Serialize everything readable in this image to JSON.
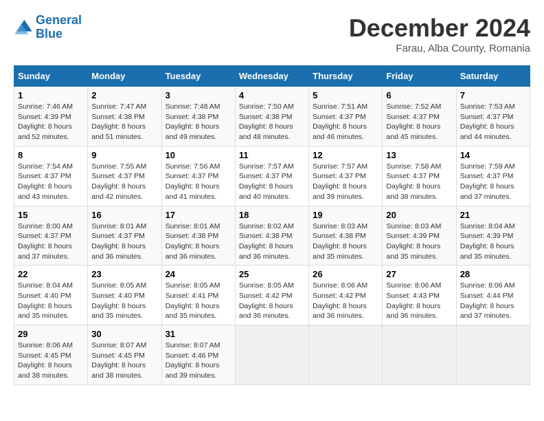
{
  "logo": {
    "line1": "General",
    "line2": "Blue"
  },
  "title": "December 2024",
  "subtitle": "Farau, Alba County, Romania",
  "days_header": [
    "Sunday",
    "Monday",
    "Tuesday",
    "Wednesday",
    "Thursday",
    "Friday",
    "Saturday"
  ],
  "weeks": [
    [
      {
        "day": "1",
        "sunrise": "7:46 AM",
        "sunset": "4:39 PM",
        "daylight": "8 hours and 52 minutes."
      },
      {
        "day": "2",
        "sunrise": "7:47 AM",
        "sunset": "4:38 PM",
        "daylight": "8 hours and 51 minutes."
      },
      {
        "day": "3",
        "sunrise": "7:48 AM",
        "sunset": "4:38 PM",
        "daylight": "8 hours and 49 minutes."
      },
      {
        "day": "4",
        "sunrise": "7:50 AM",
        "sunset": "4:38 PM",
        "daylight": "8 hours and 48 minutes."
      },
      {
        "day": "5",
        "sunrise": "7:51 AM",
        "sunset": "4:37 PM",
        "daylight": "8 hours and 46 minutes."
      },
      {
        "day": "6",
        "sunrise": "7:52 AM",
        "sunset": "4:37 PM",
        "daylight": "8 hours and 45 minutes."
      },
      {
        "day": "7",
        "sunrise": "7:53 AM",
        "sunset": "4:37 PM",
        "daylight": "8 hours and 44 minutes."
      }
    ],
    [
      {
        "day": "8",
        "sunrise": "7:54 AM",
        "sunset": "4:37 PM",
        "daylight": "8 hours and 43 minutes."
      },
      {
        "day": "9",
        "sunrise": "7:55 AM",
        "sunset": "4:37 PM",
        "daylight": "8 hours and 42 minutes."
      },
      {
        "day": "10",
        "sunrise": "7:56 AM",
        "sunset": "4:37 PM",
        "daylight": "8 hours and 41 minutes."
      },
      {
        "day": "11",
        "sunrise": "7:57 AM",
        "sunset": "4:37 PM",
        "daylight": "8 hours and 40 minutes."
      },
      {
        "day": "12",
        "sunrise": "7:57 AM",
        "sunset": "4:37 PM",
        "daylight": "8 hours and 39 minutes."
      },
      {
        "day": "13",
        "sunrise": "7:58 AM",
        "sunset": "4:37 PM",
        "daylight": "8 hours and 38 minutes."
      },
      {
        "day": "14",
        "sunrise": "7:59 AM",
        "sunset": "4:37 PM",
        "daylight": "8 hours and 37 minutes."
      }
    ],
    [
      {
        "day": "15",
        "sunrise": "8:00 AM",
        "sunset": "4:37 PM",
        "daylight": "8 hours and 37 minutes."
      },
      {
        "day": "16",
        "sunrise": "8:01 AM",
        "sunset": "4:37 PM",
        "daylight": "8 hours and 36 minutes."
      },
      {
        "day": "17",
        "sunrise": "8:01 AM",
        "sunset": "4:38 PM",
        "daylight": "8 hours and 36 minutes."
      },
      {
        "day": "18",
        "sunrise": "8:02 AM",
        "sunset": "4:38 PM",
        "daylight": "8 hours and 36 minutes."
      },
      {
        "day": "19",
        "sunrise": "8:03 AM",
        "sunset": "4:38 PM",
        "daylight": "8 hours and 35 minutes."
      },
      {
        "day": "20",
        "sunrise": "8:03 AM",
        "sunset": "4:39 PM",
        "daylight": "8 hours and 35 minutes."
      },
      {
        "day": "21",
        "sunrise": "8:04 AM",
        "sunset": "4:39 PM",
        "daylight": "8 hours and 35 minutes."
      }
    ],
    [
      {
        "day": "22",
        "sunrise": "8:04 AM",
        "sunset": "4:40 PM",
        "daylight": "8 hours and 35 minutes."
      },
      {
        "day": "23",
        "sunrise": "8:05 AM",
        "sunset": "4:40 PM",
        "daylight": "8 hours and 35 minutes."
      },
      {
        "day": "24",
        "sunrise": "8:05 AM",
        "sunset": "4:41 PM",
        "daylight": "8 hours and 35 minutes."
      },
      {
        "day": "25",
        "sunrise": "8:05 AM",
        "sunset": "4:42 PM",
        "daylight": "8 hours and 36 minutes."
      },
      {
        "day": "26",
        "sunrise": "8:06 AM",
        "sunset": "4:42 PM",
        "daylight": "8 hours and 36 minutes."
      },
      {
        "day": "27",
        "sunrise": "8:06 AM",
        "sunset": "4:43 PM",
        "daylight": "8 hours and 36 minutes."
      },
      {
        "day": "28",
        "sunrise": "8:06 AM",
        "sunset": "4:44 PM",
        "daylight": "8 hours and 37 minutes."
      }
    ],
    [
      {
        "day": "29",
        "sunrise": "8:06 AM",
        "sunset": "4:45 PM",
        "daylight": "8 hours and 38 minutes."
      },
      {
        "day": "30",
        "sunrise": "8:07 AM",
        "sunset": "4:45 PM",
        "daylight": "8 hours and 38 minutes."
      },
      {
        "day": "31",
        "sunrise": "8:07 AM",
        "sunset": "4:46 PM",
        "daylight": "8 hours and 39 minutes."
      },
      null,
      null,
      null,
      null
    ]
  ]
}
